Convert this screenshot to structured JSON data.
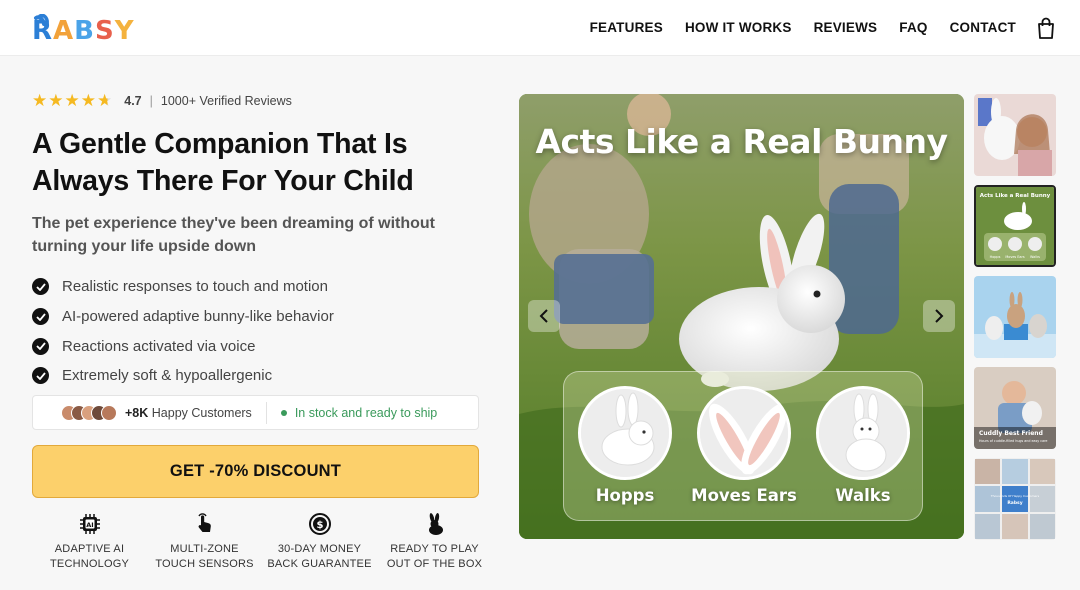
{
  "brand": {
    "name": "RABSY",
    "letters": [
      {
        "ch": "R",
        "color": "#2c7fd6"
      },
      {
        "ch": "A",
        "color": "#f2a23a"
      },
      {
        "ch": "B",
        "color": "#4aa3e8"
      },
      {
        "ch": "S",
        "color": "#e8604c"
      },
      {
        "ch": "Y",
        "color": "#f4b23e"
      }
    ]
  },
  "nav": {
    "features": "FEATURES",
    "how_it_works": "HOW IT WORKS",
    "reviews": "REVIEWS",
    "faq": "FAQ",
    "contact": "CONTACT"
  },
  "rating": {
    "score": "4.7",
    "separator": "|",
    "reviews": "1000+ Verified Reviews",
    "stars": 4.7
  },
  "headline": "A Gentle Companion That Is Always There For Your Child",
  "subheadline": "The pet experience they've been dreaming of without turning your life upside down",
  "bullets": [
    "Realistic responses to touch and motion",
    "AI-powered adaptive bunny-like behavior",
    "Reactions activated via voice",
    "Extremely soft & hypoallergenic"
  ],
  "social_proof": {
    "count": "+8K",
    "label": "Happy Customers",
    "stock": "In stock and ready to ship"
  },
  "cta": "GET -70% DISCOUNT",
  "features": [
    {
      "line1": "ADAPTIVE AI",
      "line2": "TECHNOLOGY",
      "icon": "ai-chip-icon"
    },
    {
      "line1": "MULTI-ZONE",
      "line2": "TOUCH SENSORS",
      "icon": "touch-hand-icon"
    },
    {
      "line1": "30-DAY MONEY",
      "line2": "BACK GUARANTEE",
      "icon": "money-back-icon"
    },
    {
      "line1": "READY TO PLAY",
      "line2": "OUT OF THE BOX",
      "icon": "bunny-icon"
    }
  ],
  "hero": {
    "title": "Acts Like a Real Bunny",
    "actions": [
      "Hopps",
      "Moves Ears",
      "Walks"
    ]
  },
  "thumbnails": {
    "t2": {
      "title": "Acts Like a Real Bunny",
      "labels": [
        "Hopps",
        "Moves Ears",
        "Walks"
      ]
    },
    "t4": {
      "title": "Cuddly Best Friend",
      "caption": "Hours of cuddle-filled hugs and easy care"
    },
    "t5": {
      "badge": "Thousands Of Happy Customers",
      "brand": "Rabsy"
    }
  },
  "colors": {
    "cta": "#fcd06b",
    "stock": "#3a9a5b",
    "star": "#f5b921"
  }
}
